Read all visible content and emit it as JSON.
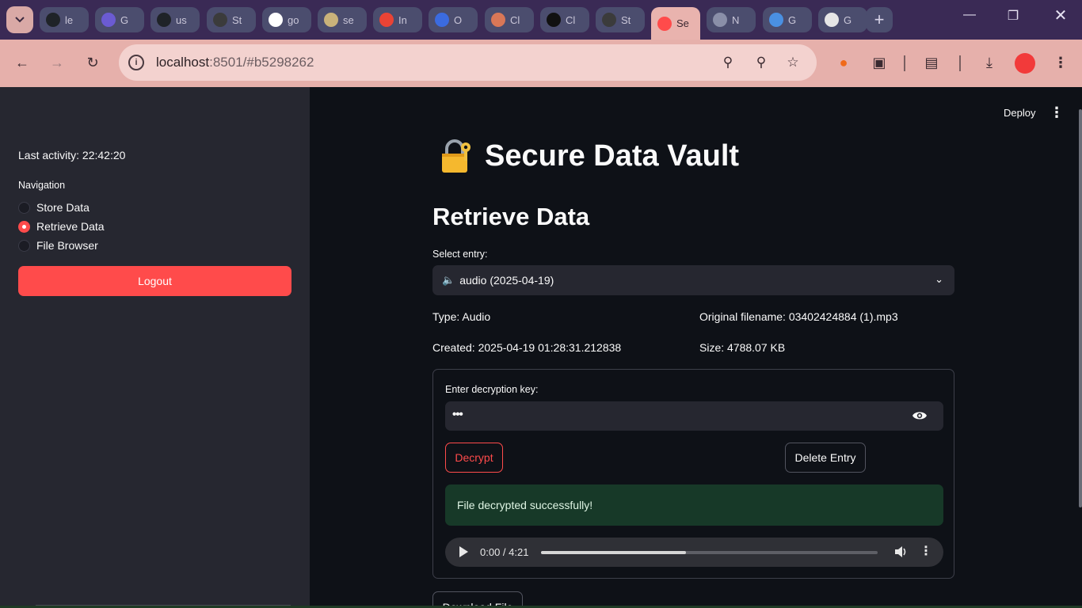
{
  "browser": {
    "tabs": [
      {
        "label": "le",
        "icon": "github-icon",
        "color": "#1f2328"
      },
      {
        "label": "G",
        "icon": "list-icon",
        "color": "#6b5bd2"
      },
      {
        "label": "us",
        "icon": "github-icon",
        "color": "#1f2328"
      },
      {
        "label": "St",
        "icon": "openai-icon",
        "color": "#3b3b3b"
      },
      {
        "label": "go",
        "icon": "google-icon",
        "color": "#ffffff"
      },
      {
        "label": "se",
        "icon": "crown-icon",
        "color": "#c9b27a"
      },
      {
        "label": "In",
        "icon": "gmail-icon",
        "color": "#ea4335"
      },
      {
        "label": "O",
        "icon": "person-icon",
        "color": "#3b6be0"
      },
      {
        "label": "Cl",
        "icon": "claude-icon",
        "color": "#d97757"
      },
      {
        "label": "Cl",
        "icon": "anthropic-icon",
        "color": "#111111"
      },
      {
        "label": "St",
        "icon": "openai-icon",
        "color": "#3b3b3b"
      },
      {
        "label": "Se",
        "icon": "streamlit-icon",
        "color": "#ff4b4b",
        "active": true
      },
      {
        "label": "N",
        "icon": "globe-icon",
        "color": "#8a8fa8"
      },
      {
        "label": "G",
        "icon": "gemini-icon",
        "color": "#4a90e2"
      },
      {
        "label": "G",
        "icon": "block-icon",
        "color": "#e6e6e6"
      }
    ],
    "url_host": "localhost",
    "url_rest": ":8501/#b5298262"
  },
  "sidebar": {
    "last_activity": "Last activity: 22:42:20",
    "nav_label": "Navigation",
    "nav_items": [
      {
        "label": "Store Data",
        "selected": false
      },
      {
        "label": "Retrieve Data",
        "selected": true
      },
      {
        "label": "File Browser",
        "selected": false
      }
    ],
    "logout_label": "Logout"
  },
  "header": {
    "deploy_label": "Deploy"
  },
  "main": {
    "title": "Secure Data Vault",
    "section_title": "Retrieve Data",
    "select_label": "Select entry:",
    "select_value": "audio (2025-04-19)",
    "type": "Type: Audio",
    "original_filename": "Original filename: 03402424884 (1).mp3",
    "created": "Created: 2025-04-19 01:28:31.212838",
    "size": "Size: 4788.07 KB",
    "key_label": "Enter decryption key:",
    "key_value": "•••",
    "decrypt_label": "Decrypt",
    "delete_label": "Delete Entry",
    "success_message": "File decrypted successfully!",
    "audio_time": "0:00 / 4:21",
    "audio_progress": 0.43,
    "download_label": "Download File"
  },
  "colors": {
    "accent": "#ff4b4b",
    "success_bg": "#173928",
    "sidebar_bg": "#262730",
    "main_bg": "#0e1117"
  }
}
